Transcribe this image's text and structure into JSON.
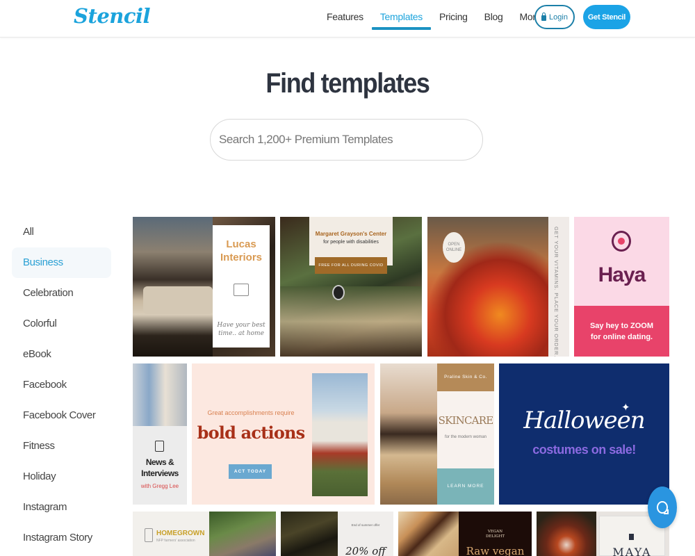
{
  "header": {
    "logo": "Stencil",
    "nav": [
      {
        "label": "Features"
      },
      {
        "label": "Templates",
        "active": true
      },
      {
        "label": "Pricing"
      },
      {
        "label": "Blog"
      },
      {
        "label": "More"
      }
    ],
    "more_caret": "▾",
    "login_label": "Login",
    "cta_label": "Get Stencil"
  },
  "hero": {
    "title": "Find templates",
    "search_placeholder": "Search 1,200+ Premium Templates"
  },
  "sidebar": {
    "active": "Business",
    "items": [
      {
        "label": "All"
      },
      {
        "label": "Business"
      },
      {
        "label": "Celebration"
      },
      {
        "label": "Colorful"
      },
      {
        "label": "eBook"
      },
      {
        "label": "Facebook"
      },
      {
        "label": "Facebook Cover"
      },
      {
        "label": "Fitness"
      },
      {
        "label": "Holiday"
      },
      {
        "label": "Instagram"
      },
      {
        "label": "Instagram Story"
      }
    ]
  },
  "templates": {
    "lucas": {
      "title_1": "Lucas",
      "title_2": "Interiors",
      "tagline_1": "Have your best",
      "tagline_2": "time.. at home",
      "icon": "bed-icon"
    },
    "margaret": {
      "title": "Margaret Grayson's Center",
      "subtitle": "for people with disabilities",
      "banner": "FREE FOR ALL DURING COVID"
    },
    "market": {
      "badge_1": "OPEN",
      "badge_2": "ONLINE",
      "side_text": "GET YOUR VITAMINS. PLACE YOUR ORDER."
    },
    "haya": {
      "brand": "Haya",
      "line_1": "Say hey to ZOOM",
      "line_2": "for online dating.",
      "icon": "heart-chat-icon"
    },
    "news": {
      "title_1": "News &",
      "title_2": "Interviews",
      "byline": "with Gregg Lee",
      "icon": "document-icon"
    },
    "bold": {
      "kicker": "Great accomplishments require",
      "headline": "bold actions",
      "cta": "ACT TODAY"
    },
    "skincare": {
      "brand": "Praline Skin & Co.",
      "title": "SKINCARE",
      "subtitle": "for the modern woman",
      "cta": "LEARN MORE"
    },
    "halloween": {
      "title": "Halloween",
      "subtitle": "costumes on sale!",
      "icon": "witch-icon"
    },
    "homegrown": {
      "title": "HOMEGROWN",
      "subtitle": "NFP farmers' association"
    },
    "summer": {
      "kicker": "End of summer offer",
      "headline": "20% off"
    },
    "vegan": {
      "kicker_1": "VEGAN",
      "kicker_2": "DELIGHT",
      "headline": "Raw vegan"
    },
    "maya": {
      "title": "MAYA"
    }
  },
  "colors": {
    "brand": "#1ba3dc",
    "nav_underline": "#1b92c2",
    "cta": "#1ba3e6",
    "chat": "#2a95e0",
    "haya_pink": "#e8436a",
    "halloween_navy": "#0f2d6e"
  }
}
